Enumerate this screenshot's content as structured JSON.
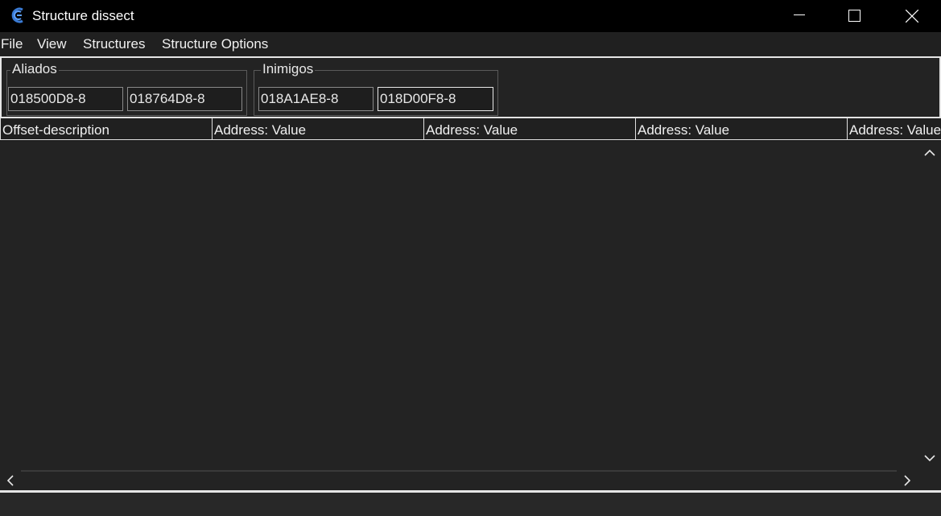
{
  "window": {
    "title": "Structure dissect",
    "app_icon": "cheat-engine-icon"
  },
  "menu": {
    "items": [
      "File",
      "View",
      "Structures",
      "Structure Options"
    ]
  },
  "groups": [
    {
      "name": "Aliados",
      "addresses": [
        "018500D8-8",
        "018764D8-8"
      ]
    },
    {
      "name": "Inimigos",
      "addresses": [
        "018A1AE8-8",
        "018D00F8-8"
      ]
    }
  ],
  "columns": [
    "Offset-description",
    "Address: Value",
    "Address: Value",
    "Address: Value",
    "Address: Value"
  ],
  "colors": {
    "background": "#232323",
    "titlebar": "#000000",
    "text": "#e8e8e8",
    "border": "#e6e6e6"
  }
}
